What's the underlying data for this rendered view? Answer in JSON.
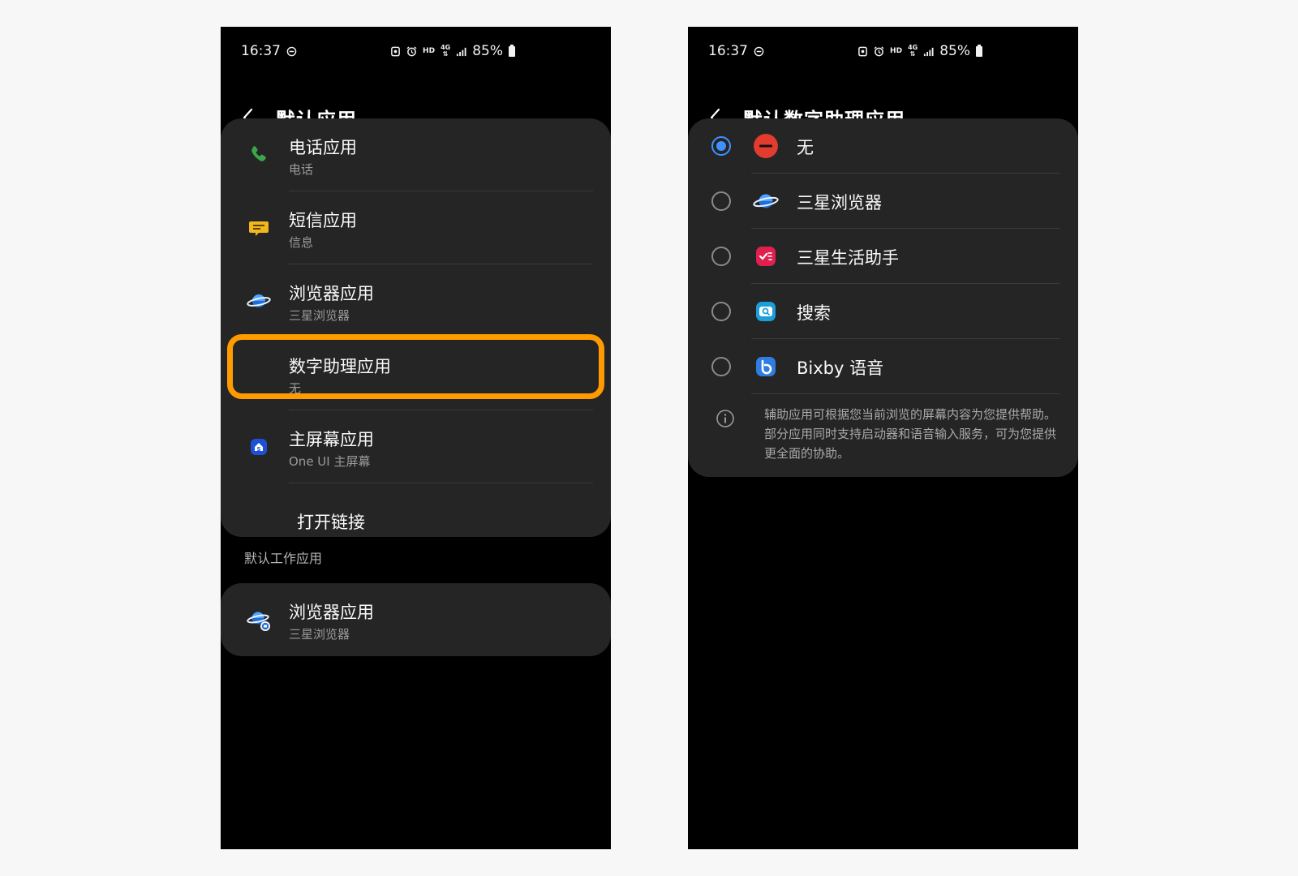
{
  "colors": {
    "accent_highlight": "#ff9b00",
    "radio_selected": "#3e91ff",
    "card_bg": "#252525",
    "screen_bg": "#000000",
    "page_bg": "#f7f7f7"
  },
  "status_bar": {
    "time": "16:37",
    "hd": "HD",
    "net_top": "4G",
    "net_bottom": "⇅",
    "battery": "85%",
    "icons": [
      "do-not-disturb-icon",
      "nfc-icon",
      "alarm-icon",
      "hd-icon",
      "4g-icon",
      "signal-icon",
      "battery-icon"
    ]
  },
  "left_screen": {
    "title": "默认应用",
    "items": [
      {
        "title": "电话应用",
        "subtitle": "电话",
        "icon": "phone-icon"
      },
      {
        "title": "短信应用",
        "subtitle": "信息",
        "icon": "message-icon"
      },
      {
        "title": "浏览器应用",
        "subtitle": "三星浏览器",
        "icon": "browser-icon"
      },
      {
        "title": "数字助理应用",
        "subtitle": "无",
        "icon": ""
      },
      {
        "title": "主屏幕应用",
        "subtitle": "One UI 主屏幕",
        "icon": "home-icon"
      },
      {
        "title": "打开链接",
        "subtitle": "",
        "icon": ""
      }
    ],
    "section_label": "默认工作应用",
    "work_item": {
      "title": "浏览器应用",
      "subtitle": "三星浏览器",
      "icon": "work-browser-icon"
    }
  },
  "right_screen": {
    "title": "默认数字助理应用",
    "options": [
      {
        "label": "无",
        "selected": true,
        "icon": "none-icon"
      },
      {
        "label": "三星浏览器",
        "selected": false,
        "icon": "browser-icon"
      },
      {
        "label": "三星生活助手",
        "selected": false,
        "icon": "life-assistant-icon"
      },
      {
        "label": "搜索",
        "selected": false,
        "icon": "search-icon"
      },
      {
        "label": "Bixby 语音",
        "selected": false,
        "icon": "bixby-icon"
      }
    ],
    "info_text": "辅助应用可根据您当前浏览的屏幕内容为您提供帮助。部分应用同时支持启动器和语音输入服务，可为您提供更全面的协助。"
  }
}
